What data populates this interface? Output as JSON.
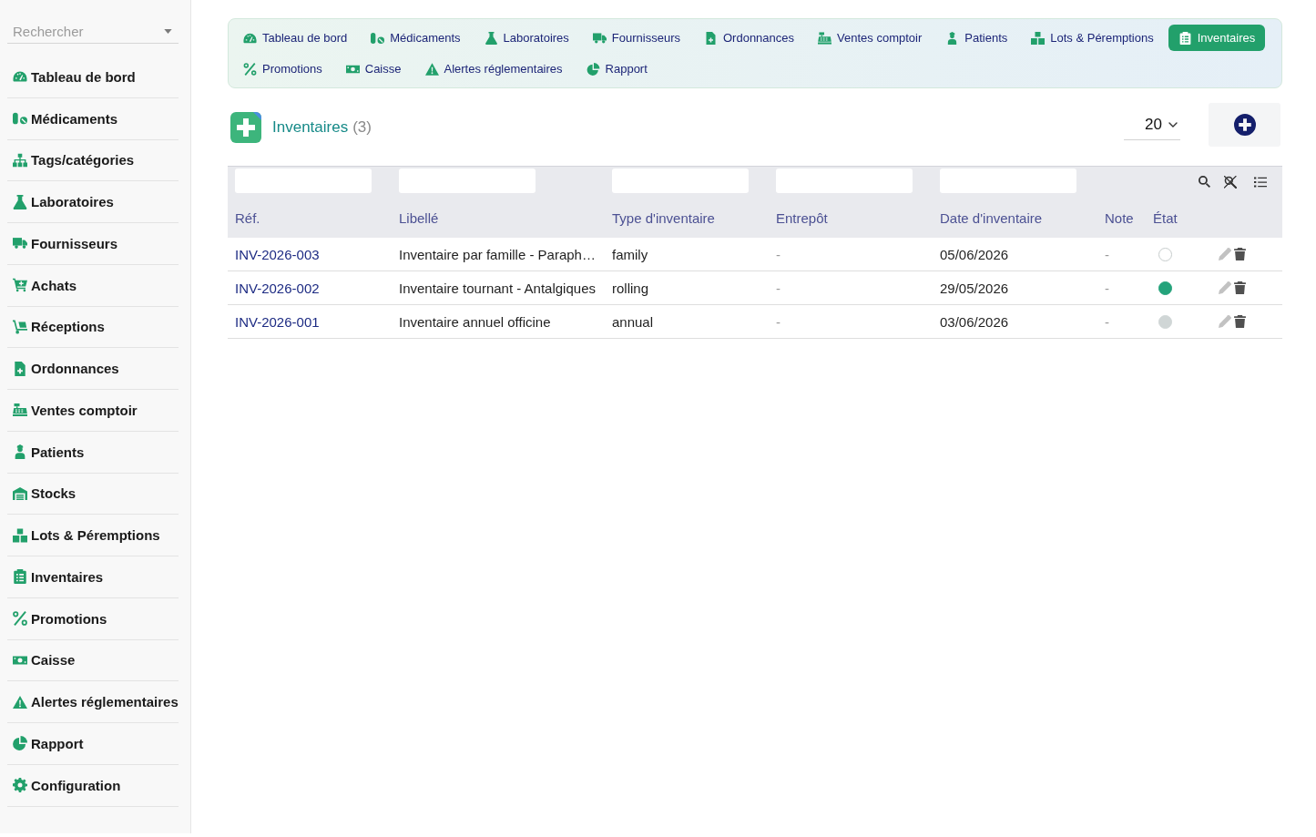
{
  "sidebar": {
    "search": {
      "placeholder": "Rechercher"
    },
    "items": [
      {
        "label": "Tableau de bord"
      },
      {
        "label": "Médicaments"
      },
      {
        "label": "Tags/catégories"
      },
      {
        "label": "Laboratoires"
      },
      {
        "label": "Fournisseurs"
      },
      {
        "label": "Achats"
      },
      {
        "label": "Réceptions"
      },
      {
        "label": "Ordonnances"
      },
      {
        "label": "Ventes comptoir"
      },
      {
        "label": "Patients"
      },
      {
        "label": "Stocks"
      },
      {
        "label": "Lots & Péremptions"
      },
      {
        "label": "Inventaires"
      },
      {
        "label": "Promotions"
      },
      {
        "label": "Caisse"
      },
      {
        "label": "Alertes réglementaires"
      },
      {
        "label": "Rapport"
      },
      {
        "label": "Configuration"
      }
    ]
  },
  "nav": {
    "items": [
      {
        "label": "Tableau de bord",
        "selected": false
      },
      {
        "label": "Médicaments",
        "selected": false
      },
      {
        "label": "Laboratoires",
        "selected": false
      },
      {
        "label": "Fournisseurs",
        "selected": false
      },
      {
        "label": "Ordonnances",
        "selected": false
      },
      {
        "label": "Ventes comptoir",
        "selected": false
      },
      {
        "label": "Patients",
        "selected": false
      },
      {
        "label": "Lots & Péremptions",
        "selected": false
      },
      {
        "label": "Inventaires",
        "selected": true
      },
      {
        "label": "Promotions",
        "selected": false
      },
      {
        "label": "Caisse",
        "selected": false
      },
      {
        "label": "Alertes réglementaires",
        "selected": false
      },
      {
        "label": "Rapport",
        "selected": false
      }
    ]
  },
  "header": {
    "title": "Inventaires",
    "count": "(3)"
  },
  "pagination": {
    "page_size": "20"
  },
  "table": {
    "columns": [
      {
        "label": "Réf.",
        "filter": true
      },
      {
        "label": "Libellé",
        "filter": true
      },
      {
        "label": "Type d'inventaire",
        "filter": true
      },
      {
        "label": "Entrepôt",
        "filter": true
      },
      {
        "label": "Date d'inventaire",
        "filter": true
      },
      {
        "label": "Note",
        "filter": false
      },
      {
        "label": "État",
        "filter": false
      }
    ],
    "rows": [
      {
        "ref": "INV-2026-003",
        "label": "Inventaire par famille - Paraph…",
        "type": "family",
        "warehouse": "-",
        "date": "05/06/2026",
        "note": "-",
        "status": {
          "kind": "ring",
          "color": "#c6cccc"
        }
      },
      {
        "ref": "INV-2026-002",
        "label": "Inventaire tournant - Antalgiques",
        "type": "rolling",
        "warehouse": "-",
        "date": "29/05/2026",
        "note": "-",
        "status": {
          "kind": "filled",
          "color": "#24a37b"
        }
      },
      {
        "ref": "INV-2026-001",
        "label": "Inventaire annuel officine",
        "type": "annual",
        "warehouse": "-",
        "date": "03/06/2026",
        "note": "-",
        "status": {
          "kind": "filled",
          "color": "#d0d6d6"
        }
      }
    ]
  }
}
